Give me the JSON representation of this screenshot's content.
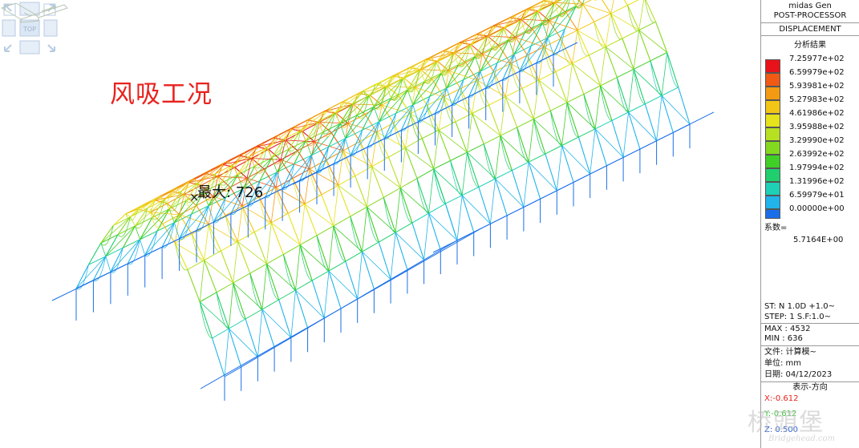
{
  "viewport": {
    "case_title": "风吸工况",
    "max_label": "最大: 726",
    "max_marker": "×",
    "viewcube_label": "TOP"
  },
  "panel": {
    "product": "midas Gen",
    "module": "POST-PROCESSOR",
    "result_type": "DISPLACEMENT",
    "legend_title": "分析结果",
    "legend": [
      {
        "value": "7.25977e+02",
        "color": "#e8131a"
      },
      {
        "value": "6.59979e+02",
        "color": "#f05a14"
      },
      {
        "value": "5.93981e+02",
        "color": "#f39a12"
      },
      {
        "value": "5.27983e+02",
        "color": "#f3c615"
      },
      {
        "value": "4.61986e+02",
        "color": "#e6e21c"
      },
      {
        "value": "3.95988e+02",
        "color": "#b8e022"
      },
      {
        "value": "3.29990e+02",
        "color": "#83d91f"
      },
      {
        "value": "2.63992e+02",
        "color": "#3fcf27"
      },
      {
        "value": "1.97994e+02",
        "color": "#1fcf6e"
      },
      {
        "value": "1.31996e+02",
        "color": "#1ed0b5"
      },
      {
        "value": "6.59979e+01",
        "color": "#20b4ea"
      },
      {
        "value": "0.00000e+00",
        "color": "#1a6fe8"
      }
    ],
    "factor_label": "系数=",
    "factor_value": "5.7164E+00",
    "st": "ST: N 1.0D +1.0~",
    "step": "STEP: 1 S.F:1.0~",
    "max": "MAX : 4532",
    "min": "MIN : 636",
    "file": "文件: 计算模~",
    "unit": "单位: mm",
    "date": "日期: 04/12/2023",
    "direction_title": "表示-方向",
    "x": "X:-0.612",
    "y": "Y:-0.612",
    "z": "Z: 0.500",
    "x_color": "#e8221e",
    "y_color": "#3cc83c",
    "z_color": "#2a5fd8"
  },
  "watermark": {
    "cn": "桥頭堡",
    "en": "Bridgehead.com"
  }
}
